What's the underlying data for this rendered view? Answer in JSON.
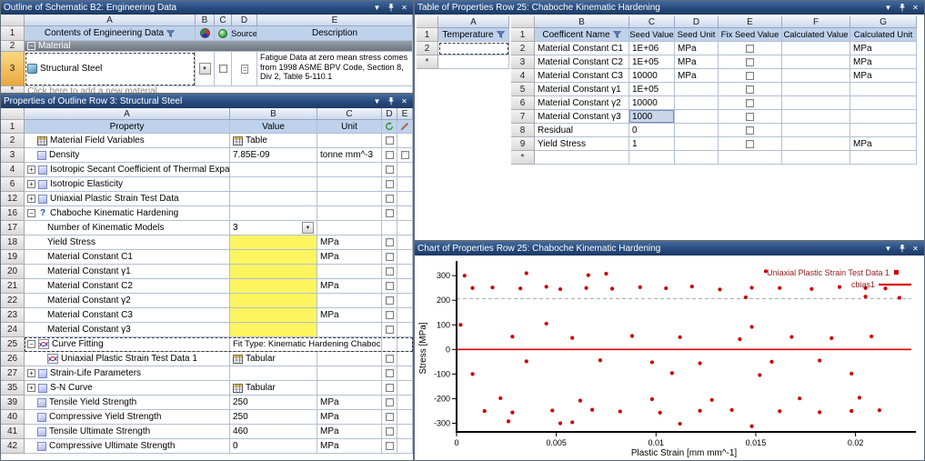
{
  "icons": {
    "menu": "▼",
    "close": "✕",
    "dropdown": "▼",
    "expand": "+",
    "collapse": "−"
  },
  "colors": {
    "accent_red": "#cc0000",
    "incomplete_yellow": "#fdf55f",
    "selection_blue": "#c9d6ea",
    "titlebar_blue": "#27497b"
  },
  "outline": {
    "title": "Outline of Schematic B2: Engineering Data",
    "letters": [
      "A",
      "B",
      "C",
      "D",
      "E"
    ],
    "rows": {
      "header": {
        "num": "1",
        "contents": "Contents of Engineering Data",
        "source": "Source",
        "description": "Description"
      },
      "material_group": {
        "num": "2",
        "label": "Material"
      },
      "material": {
        "num": "3",
        "name": "Structural Steel",
        "description": "Fatigue Data at zero mean stress comes from 1998 ASME BPV Code, Section 8, Div 2, Table 5-110.1"
      },
      "add": {
        "num": "*",
        "label": "Click here to add a new material"
      }
    }
  },
  "properties": {
    "title": "Properties of Outline Row 3: Structural Steel",
    "letters": [
      "A",
      "B",
      "C",
      "D",
      "E"
    ],
    "header": {
      "num": "1",
      "property": "Property",
      "value": "Value",
      "unit": "Unit"
    },
    "rows": [
      {
        "num": "2",
        "indent": 1,
        "icon": "table",
        "property": "Material Field Variables",
        "value": "Table",
        "value_icon": true,
        "d": true
      },
      {
        "num": "3",
        "indent": 1,
        "icon": "prop",
        "property": "Density",
        "value": "7.85E-09",
        "unit": "tonne mm^-3",
        "d": true,
        "e": true
      },
      {
        "num": "4",
        "exp": "plus",
        "icon": "prop",
        "property": "Isotropic Secant Coefficient of Thermal Expansion",
        "d": true
      },
      {
        "num": "6",
        "exp": "plus",
        "icon": "prop",
        "property": "Isotropic Elasticity",
        "d": true
      },
      {
        "num": "12",
        "exp": "plus",
        "icon": "prop",
        "property": "Uniaxial Plastic Strain Test Data",
        "d": true
      },
      {
        "num": "16",
        "exp": "minus",
        "icon": "question",
        "property": "Chaboche Kinematic Hardening",
        "d": true
      },
      {
        "num": "17",
        "indent": 2,
        "property": "Number of Kinematic Models",
        "value": "3",
        "value_style": "dropdown"
      },
      {
        "num": "18",
        "indent": 2,
        "property": "Yield Stress",
        "value": "",
        "value_style": "yellow",
        "unit": "MPa",
        "d": true
      },
      {
        "num": "19",
        "indent": 2,
        "property": "Material Constant C1",
        "value": "",
        "value_style": "yellow",
        "unit": "MPa",
        "d": true
      },
      {
        "num": "20",
        "indent": 2,
        "property": "Material Constant γ1",
        "value": "",
        "value_style": "yellow",
        "d": true
      },
      {
        "num": "21",
        "indent": 2,
        "property": "Material Constant C2",
        "value": "",
        "value_style": "yellow",
        "unit": "MPa",
        "d": true
      },
      {
        "num": "22",
        "indent": 2,
        "property": "Material Constant γ2",
        "value": "",
        "value_style": "yellow",
        "d": true
      },
      {
        "num": "23",
        "indent": 2,
        "property": "Material Constant C3",
        "value": "",
        "value_style": "yellow",
        "unit": "MPa",
        "d": true
      },
      {
        "num": "24",
        "indent": 2,
        "property": "Material Constant γ3",
        "value": "",
        "value_style": "yellow",
        "d": true
      },
      {
        "num": "25",
        "exp": "minus",
        "icon": "curve",
        "property": "Curve Fitting",
        "value": "Fit Type: Kinematic Hardening Chaboche",
        "value_span": true,
        "selected": true
      },
      {
        "num": "26",
        "indent": 2,
        "icon": "curve",
        "property": "Uniaxial Plastic Strain Test Data 1",
        "value": "Tabular",
        "value_icon": true,
        "d": true
      },
      {
        "num": "27",
        "exp": "plus",
        "icon": "prop",
        "property": "Strain-Life Parameters",
        "d": true
      },
      {
        "num": "35",
        "exp": "plus",
        "icon": "prop",
        "property": "S-N Curve",
        "value": "Tabular",
        "value_icon": true,
        "d": true
      },
      {
        "num": "39",
        "indent": 1,
        "icon": "prop",
        "property": "Tensile Yield Strength",
        "value": "250",
        "unit": "MPa",
        "d": true
      },
      {
        "num": "40",
        "indent": 1,
        "icon": "prop",
        "property": "Compressive Yield Strength",
        "value": "250",
        "unit": "MPa",
        "d": true
      },
      {
        "num": "41",
        "indent": 1,
        "icon": "prop",
        "property": "Tensile Ultimate Strength",
        "value": "460",
        "unit": "MPa",
        "d": true
      },
      {
        "num": "42",
        "indent": 1,
        "icon": "prop",
        "property": "Compressive Ultimate Strength",
        "value": "0",
        "unit": "MPa",
        "d": true
      }
    ]
  },
  "table": {
    "title": "Table of Properties Row 25: Chaboche Kinematic Hardening",
    "temp_table": {
      "letter": "A",
      "rows": [
        {
          "num": "1",
          "label": "Temperature"
        },
        {
          "num": "2",
          "label": ""
        },
        {
          "num": "*",
          "label": ""
        }
      ]
    },
    "main_table": {
      "letters": [
        "B",
        "C",
        "D",
        "E",
        "F",
        "G"
      ],
      "header": {
        "num": "1",
        "cells": [
          "Coefficent Name",
          "Seed Value",
          "Seed Unit",
          "Fix Seed Value",
          "Calculated Value",
          "Calculated Unit"
        ]
      },
      "rows": [
        {
          "num": "2",
          "name": "Material Constant C1",
          "seed": "1E+06",
          "seed_unit": "MPa",
          "fix": false,
          "calc": "",
          "calc_unit": "MPa"
        },
        {
          "num": "3",
          "name": "Material Constant C2",
          "seed": "1E+05",
          "seed_unit": "MPa",
          "fix": false,
          "calc": "",
          "calc_unit": "MPa"
        },
        {
          "num": "4",
          "name": "Material Constant C3",
          "seed": "10000",
          "seed_unit": "MPa",
          "fix": false,
          "calc": "",
          "calc_unit": "MPa"
        },
        {
          "num": "5",
          "name": "Material Constant γ1",
          "seed": "1E+05",
          "seed_unit": "",
          "fix": false,
          "calc": "",
          "calc_unit": ""
        },
        {
          "num": "6",
          "name": "Material Constant γ2",
          "seed": "10000",
          "seed_unit": "",
          "fix": false,
          "calc": "",
          "calc_unit": ""
        },
        {
          "num": "7",
          "name": "Material Constant γ3",
          "seed": "1000",
          "seed_unit": "",
          "fix": false,
          "calc": "",
          "calc_unit": "",
          "selected": true
        },
        {
          "num": "8",
          "name": "Residual",
          "seed": "0",
          "seed_unit": "",
          "fix": false,
          "calc": "",
          "calc_unit": ""
        },
        {
          "num": "9",
          "name": "Yield Stress",
          "seed": "1",
          "seed_unit": "",
          "fix": false,
          "calc": "",
          "calc_unit": "MPa"
        },
        {
          "num": "*",
          "name": "",
          "seed": "",
          "seed_unit": "",
          "fix": null,
          "calc": "",
          "calc_unit": ""
        }
      ]
    }
  },
  "chart": {
    "title": "Chart of Properties Row 25: Chaboche Kinematic Hardening"
  },
  "chart_data": {
    "type": "scatter",
    "title": "",
    "xlabel": "Plastic Strain  [mm mm^-1]",
    "ylabel": "Stress  [MPa]",
    "xlim": [
      0,
      0.0228
    ],
    "ylim": [
      -335,
      345
    ],
    "xticks": [
      0,
      0.005,
      0.01,
      0.015,
      0.02
    ],
    "yticks": [
      -300,
      -200,
      -100,
      0,
      100,
      200,
      300
    ],
    "grid": false,
    "legend_position": "top-right",
    "legend_text_color": "#8b1a1a",
    "legend": [
      "Uniaxial Plastic Strain Test Data 1",
      "cbias1"
    ],
    "series": [
      {
        "name": "Uniaxial Plastic Strain Test Data 1",
        "type": "scatter",
        "color": "#cc0000",
        "points": [
          [
            0.0004,
            300
          ],
          [
            0.0008,
            250
          ],
          [
            0.0018,
            252
          ],
          [
            0.0002,
            100
          ],
          [
            0.0032,
            248
          ],
          [
            0.0035,
            310
          ],
          [
            0.0045,
            255
          ],
          [
            0.0052,
            245
          ],
          [
            0.0065,
            250
          ],
          [
            0.0066,
            302
          ],
          [
            0.0075,
            308
          ],
          [
            0.0078,
            247
          ],
          [
            0.0092,
            253
          ],
          [
            0.0105,
            249
          ],
          [
            0.0118,
            256
          ],
          [
            0.0132,
            244
          ],
          [
            0.0148,
            251
          ],
          [
            0.0155,
            318
          ],
          [
            0.0162,
            250
          ],
          [
            0.0178,
            246
          ],
          [
            0.0192,
            254
          ],
          [
            0.0205,
            250
          ],
          [
            0.0215,
            248
          ],
          [
            0.0145,
            212
          ],
          [
            0.0205,
            215
          ],
          [
            0.0222,
            210
          ],
          [
            0.0148,
            92
          ],
          [
            0.0045,
            105
          ],
          [
            0.0028,
            52
          ],
          [
            0.0058,
            47
          ],
          [
            0.0088,
            55
          ],
          [
            0.0112,
            50
          ],
          [
            0.0142,
            42
          ],
          [
            0.0168,
            51
          ],
          [
            0.0188,
            46
          ],
          [
            0.0208,
            53
          ],
          [
            0.0035,
            -48
          ],
          [
            0.0072,
            -44
          ],
          [
            0.0098,
            -52
          ],
          [
            0.0122,
            -56
          ],
          [
            0.0158,
            -50
          ],
          [
            0.0182,
            -45
          ],
          [
            0.0008,
            -100
          ],
          [
            0.0108,
            -96
          ],
          [
            0.0152,
            -104
          ],
          [
            0.0198,
            -98
          ],
          [
            0.0022,
            -198
          ],
          [
            0.0062,
            -208
          ],
          [
            0.0098,
            -202
          ],
          [
            0.0128,
            -205
          ],
          [
            0.0172,
            -199
          ],
          [
            0.0202,
            -196
          ],
          [
            0.0014,
            -250
          ],
          [
            0.0028,
            -256
          ],
          [
            0.0048,
            -248
          ],
          [
            0.0068,
            -245
          ],
          [
            0.0082,
            -252
          ],
          [
            0.0102,
            -257
          ],
          [
            0.0122,
            -249
          ],
          [
            0.0138,
            -246
          ],
          [
            0.0162,
            -251
          ],
          [
            0.0182,
            -255
          ],
          [
            0.0198,
            -250
          ],
          [
            0.0212,
            -247
          ],
          [
            0.0026,
            -292
          ],
          [
            0.0052,
            -300
          ],
          [
            0.0058,
            -296
          ],
          [
            0.0112,
            -302
          ],
          [
            0.0148,
            -312
          ]
        ]
      },
      {
        "name": "cbias1",
        "type": "line",
        "color": "#dd0000",
        "points": [
          [
            0,
            0
          ],
          [
            0.0228,
            0
          ]
        ]
      },
      {
        "name": "fit-guide",
        "type": "dashed-line",
        "color": "#9aa4b5",
        "points": [
          [
            0,
            207
          ],
          [
            0.0228,
            207
          ]
        ]
      }
    ]
  }
}
